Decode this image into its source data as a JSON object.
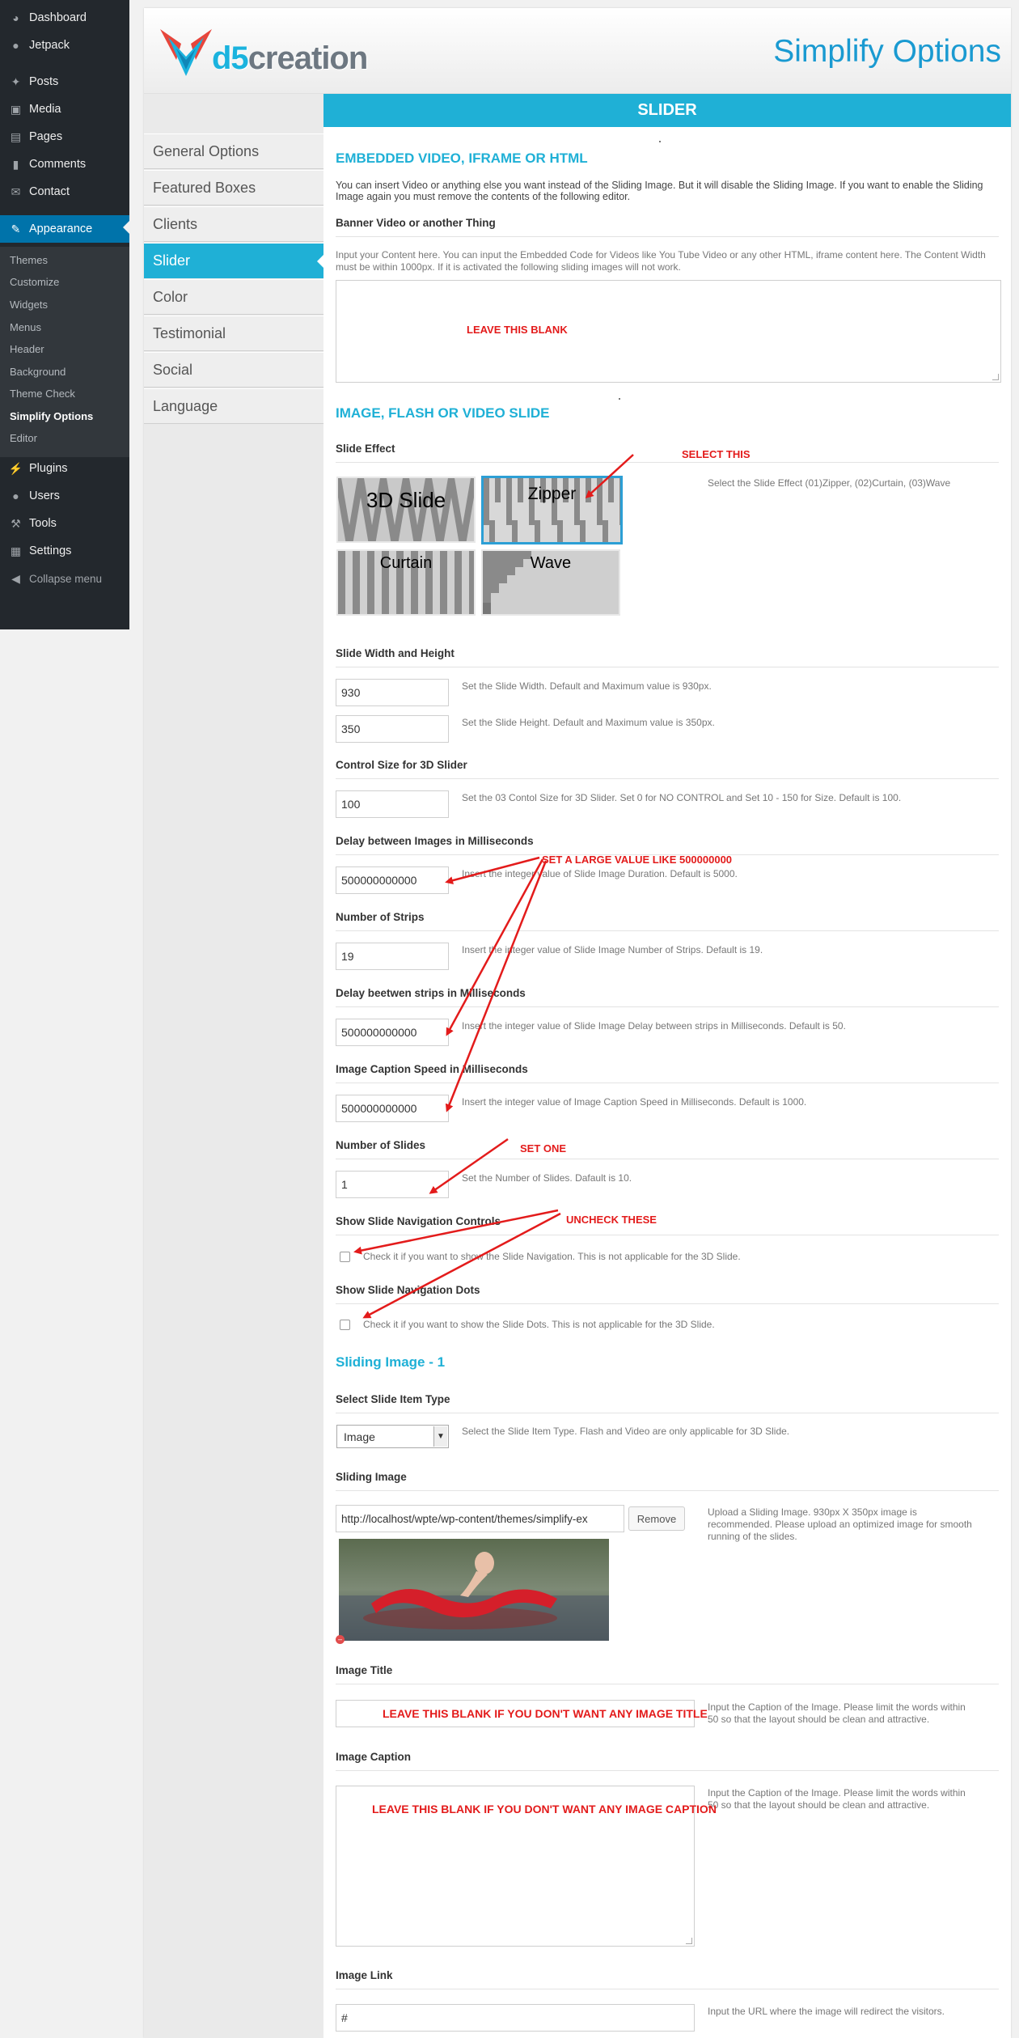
{
  "wp_menu": {
    "items": [
      {
        "label": "Dashboard",
        "icon": "dashboard-icon"
      },
      {
        "label": "Jetpack",
        "icon": "jetpack-icon"
      },
      {
        "label": "Posts",
        "icon": "pin-icon"
      },
      {
        "label": "Media",
        "icon": "media-icon"
      },
      {
        "label": "Pages",
        "icon": "pages-icon"
      },
      {
        "label": "Comments",
        "icon": "comment-icon"
      },
      {
        "label": "Contact",
        "icon": "mail-icon"
      },
      {
        "label": "Appearance",
        "icon": "brush-icon"
      },
      {
        "label": "Plugins",
        "icon": "plug-icon"
      },
      {
        "label": "Users",
        "icon": "user-icon"
      },
      {
        "label": "Tools",
        "icon": "wrench-icon"
      },
      {
        "label": "Settings",
        "icon": "settings-icon"
      },
      {
        "label": "Collapse menu",
        "icon": "collapse-icon"
      }
    ],
    "appearance_sub": [
      "Themes",
      "Customize",
      "Widgets",
      "Menus",
      "Header",
      "Background",
      "Theme Check",
      "Simplify Options",
      "Editor"
    ]
  },
  "header": {
    "logo_text_prefix": "d5",
    "logo_text_rest": "creation",
    "title": "Simplify Options"
  },
  "tabs": [
    "General Options",
    "Featured Boxes",
    "Clients",
    "Slider",
    "Color",
    "Testimonial",
    "Social",
    "Language"
  ],
  "section_bar": "SLIDER",
  "embedded": {
    "title": "EMBEDDED VIDEO, IFRAME OR HTML",
    "desc": "You can insert Video or anything else you want instead of the Sliding Image. But it will disable the Sliding Image. If you want to enable the Sliding Image again you must remove the contents of the following editor.",
    "label": "Banner Video or another Thing",
    "hint": "Input your Content here. You can input the Embedded Code for Videos like You Tube Video or any other HTML, iframe content here. The Content Width must be within 1000px. If it is activated the following sliding images will not work.",
    "annotation": "LEAVE THIS BLANK"
  },
  "slide": {
    "title": "IMAGE, FLASH OR VIDEO SLIDE",
    "effect_label": "Slide Effect",
    "effect_annotation": "SELECT THIS",
    "effects": [
      "3D Slide",
      "Zipper",
      "Curtain",
      "Wave"
    ],
    "effect_hint": "Select the Slide Effect (01)Zipper, (02)Curtain, (03)Wave",
    "size_label": "Slide Width and Height",
    "width": "930",
    "width_hint": "Set the Slide Width. Default and Maximum value is 930px.",
    "height": "350",
    "height_hint": "Set the Slide Height. Default and Maximum value is 350px.",
    "control_label": "Control Size for 3D Slider",
    "control": "100",
    "control_hint": "Set the 03 Contol Size for 3D Slider. Set 0 for NO CONTROL and Set 10 - 150 for Size. Default is 100.",
    "delay_label": "Delay between Images in Milliseconds",
    "delay": "500000000000",
    "delay_hint": "Insert the integer value of Slide Image Duration. Default is 5000.",
    "delay_annotation": "SET A LARGE VALUE LIKE 500000000",
    "strips_label": "Number of Strips",
    "strips": "19",
    "strips_hint": "Insert the integer value of Slide Image Number of Strips. Default is 19.",
    "strip_delay_label": "Delay beetwen strips in Milliseconds",
    "strip_delay": "500000000000",
    "strip_delay_hint": "Insert the integer value of Slide Image Delay between strips in Milliseconds. Default is 50.",
    "caption_speed_label": "Image Caption Speed in Milliseconds",
    "caption_speed": "500000000000",
    "caption_speed_hint": "Insert the integer value of Image Caption Speed in Milliseconds. Default is 1000.",
    "num_label": "Number of Slides",
    "num": "1",
    "num_hint": "Set the Number of Slides. Dafault is 10.",
    "num_annotation": "SET ONE",
    "nav_controls_label": "Show Slide Navigation Controls",
    "nav_controls_hint": "Check it if you want to show the Slide Navigation. This is not applicable for the 3D Slide.",
    "nav_annotation": "UNCHECK THESE",
    "nav_dots_label": "Show Slide Navigation Dots",
    "nav_dots_hint": "Check it if you want to show the Slide Dots. This is not applicable for the 3D Slide."
  },
  "sliding_image": {
    "title": "Sliding Image - 1",
    "type_label": "Select Slide Item Type",
    "type_value": "Image",
    "type_hint": "Select the Slide Item Type. Flash and Video are only applicable for 3D Slide.",
    "image_label": "Sliding Image",
    "image_url": "http://localhost/wpte/wp-content/themes/simplify-ex",
    "remove_button": "Remove",
    "image_hint": "Upload a Sliding Image. 930px X 350px image is recommended. Please upload an optimized image for smooth running of the slides.",
    "title_label": "Image Title",
    "title_hint": "Input the Caption of the Image. Please limit the words within 50 so that the layout should be clean and attractive.",
    "title_annotation": "LEAVE THIS BLANK IF YOU DON'T WANT ANY IMAGE TITLE",
    "caption_label": "Image Caption",
    "caption_hint": "Input the Caption of the Image. Please limit the words within 50 so that the layout should be clean and attractive.",
    "caption_annotation": "LEAVE THIS BLANK IF YOU DON'T WANT ANY IMAGE CAPTION",
    "link_label": "Image Link",
    "link_value": "#",
    "link_hint": "Input the URL where the image will redirect the visitors."
  },
  "colors": {
    "accent": "#1fb0d6",
    "wp_active": "#0073aa",
    "annotation": "#e31b1b"
  }
}
